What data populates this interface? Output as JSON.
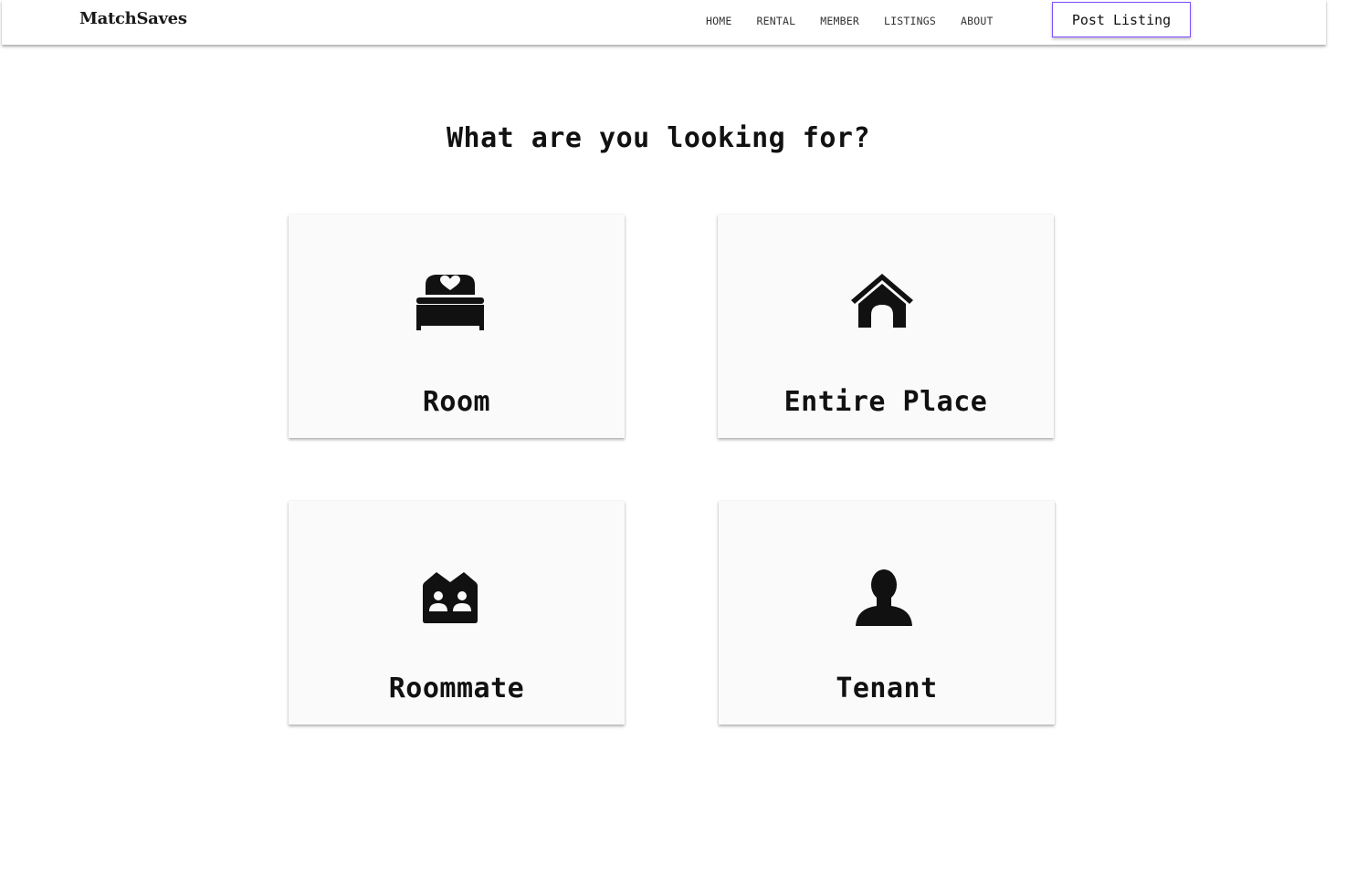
{
  "header": {
    "brand": "MatchSaves",
    "nav": [
      {
        "label": "HOME"
      },
      {
        "label": "RENTAL"
      },
      {
        "label": "MEMBER"
      },
      {
        "label": "LISTINGS"
      },
      {
        "label": "ABOUT"
      }
    ],
    "post_button": "Post Listing"
  },
  "main": {
    "title": "What are you looking for?",
    "options": [
      {
        "label": "Room",
        "icon": "bed-icon"
      },
      {
        "label": "Entire Place",
        "icon": "house-icon"
      },
      {
        "label": "Roommate",
        "icon": "roommates-icon"
      },
      {
        "label": "Tenant",
        "icon": "person-icon"
      }
    ]
  },
  "colors": {
    "accent_border": "#7c4dff",
    "card_background": "#fafafa",
    "text": "#111111"
  }
}
